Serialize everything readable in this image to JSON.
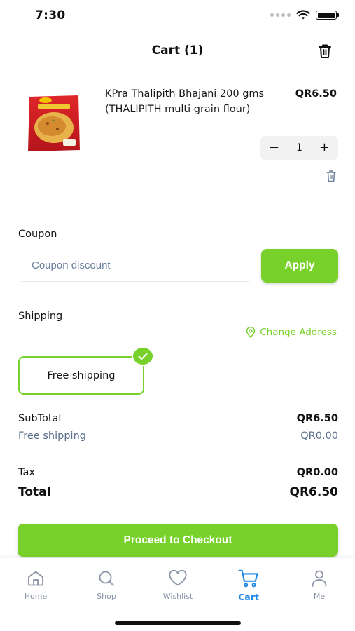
{
  "status_bar": {
    "time": "7:30"
  },
  "header": {
    "title": "Cart (1)",
    "delete_all_icon": "trash-icon"
  },
  "cart_items": [
    {
      "name": "KPra Thalipith Bhajani 200 gms (THALIPITH multi grain flour)",
      "price": "QR6.50",
      "quantity": "1",
      "decrement_label": "−",
      "increment_label": "+"
    }
  ],
  "coupon": {
    "label": "Coupon",
    "placeholder": "Coupon discount",
    "value": "",
    "apply_label": "Apply"
  },
  "shipping": {
    "label": "Shipping",
    "change_address_label": "Change Address",
    "options": [
      {
        "label": "Free shipping",
        "selected": true
      }
    ]
  },
  "summary": {
    "subtotal_label": "SubTotal",
    "subtotal_value": "QR6.50",
    "shipping_label": "Free shipping",
    "shipping_value": "QR0.00",
    "tax_label": "Tax",
    "tax_value": "QR0.00",
    "total_label": "Total",
    "total_value": "QR6.50"
  },
  "checkout_label": "Proceed to Checkout",
  "tabbar": {
    "tabs": [
      {
        "label": "Home",
        "icon": "home-icon",
        "active": false
      },
      {
        "label": "Shop",
        "icon": "search-icon",
        "active": false
      },
      {
        "label": "Wishlist",
        "icon": "heart-icon",
        "active": false
      },
      {
        "label": "Cart",
        "icon": "cart-icon",
        "active": true
      },
      {
        "label": "Me",
        "icon": "user-icon",
        "active": false
      }
    ]
  },
  "colors": {
    "accent": "#78d12a",
    "active_tab": "#1e88e5",
    "muted_text": "#5a6e8c"
  }
}
